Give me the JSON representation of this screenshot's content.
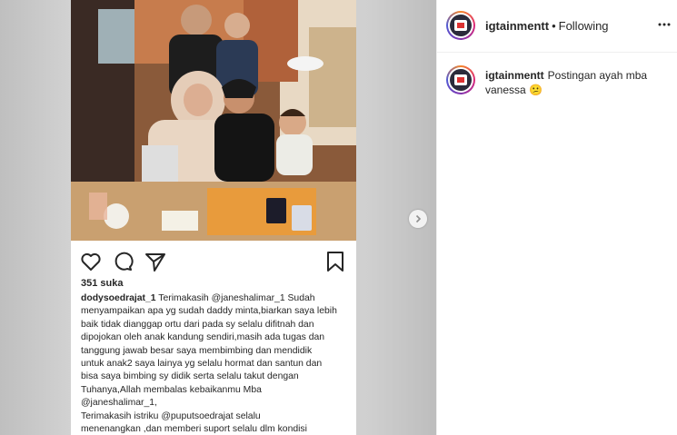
{
  "post": {
    "likes_text": "351 suka",
    "caption_user": "dodysoedrajat_1",
    "caption_text": " Terimakasih @janeshalimar_1 Sudah\nmenyampaikan apa yg sudah daddy minta,biarkan saya lebih\nbaik tidak dianggap ortu dari pada sy selalu difitnah dan\ndipojokan oleh anak kandung sendiri,masih ada tugas dan\ntanggung jawab besar saya membimbing dan mendidik\nuntuk anak2 saya lainya yg selalu hormat dan santun dan\nbisa saya bimbing sy didik serta selalu takut dengan\nTuhanya,Allah membalas kebaikanmu Mba\n@janeshalimar_1,\nTerimakasih istriku @puputsoedrajat selalu\nmenenangkan ,dan memberi suport selalu dlm kondisi",
    "icons": [
      "heart-icon",
      "comment-icon",
      "share-icon",
      "bookmark-icon"
    ]
  },
  "header": {
    "username": "igtainmentt",
    "separator": "•",
    "follow_status": "Following"
  },
  "comment": {
    "username": "igtainmentt",
    "text": "Postingan ayah mba vanessa",
    "emoji": "😕"
  },
  "colors": {
    "text": "#262626",
    "border": "#efefef",
    "panel_bg": "#ffffff",
    "media_bg": "#d4d4d4"
  }
}
